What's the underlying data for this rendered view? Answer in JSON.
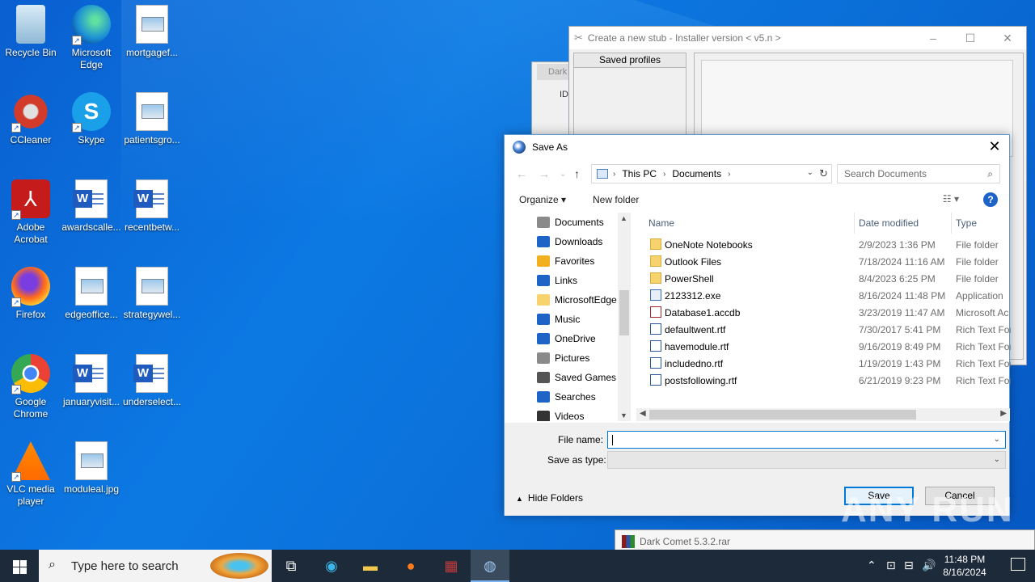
{
  "desktop": {
    "icons": [
      {
        "label": "Recycle Bin"
      },
      {
        "label": "Microsoft Edge"
      },
      {
        "label": "mortgagef..."
      },
      {
        "label": "CCleaner"
      },
      {
        "label": "Skype"
      },
      {
        "label": "patientsgro..."
      },
      {
        "label": "Adobe Acrobat"
      },
      {
        "label": "awardscalle..."
      },
      {
        "label": "recentbetw..."
      },
      {
        "label": "Firefox"
      },
      {
        "label": "edgeoffice..."
      },
      {
        "label": "strategywel..."
      },
      {
        "label": "Google Chrome"
      },
      {
        "label": "januaryvisit..."
      },
      {
        "label": "underselect..."
      },
      {
        "label": "VLC media player"
      },
      {
        "label": "moduleal.jpg"
      }
    ]
  },
  "stub_window": {
    "title": "Create a new stub - Installer version < v5.n >",
    "saved_profiles_label": "Saved profiles",
    "behind_tab": "Dark",
    "behind_col": "ID"
  },
  "dialog": {
    "title": "Save As",
    "breadcrumb": [
      "This PC",
      "Documents"
    ],
    "search_placeholder": "Search Documents",
    "organize_label": "Organize",
    "new_folder_label": "New folder",
    "tree": [
      {
        "label": "Documents",
        "icon": "documents-icon",
        "color": "#8a8a8a"
      },
      {
        "label": "Downloads",
        "icon": "downloads-icon",
        "color": "#1e63c8"
      },
      {
        "label": "Favorites",
        "icon": "star-icon",
        "color": "#f2b01e"
      },
      {
        "label": "Links",
        "icon": "links-icon",
        "color": "#1e63c8"
      },
      {
        "label": "MicrosoftEdge",
        "icon": "folder-icon",
        "color": "#f6d36d"
      },
      {
        "label": "Music",
        "icon": "music-icon",
        "color": "#1e63c8"
      },
      {
        "label": "OneDrive",
        "icon": "onedrive-icon",
        "color": "#1e63c8"
      },
      {
        "label": "Pictures",
        "icon": "pictures-icon",
        "color": "#8a8a8a"
      },
      {
        "label": "Saved Games",
        "icon": "saved-games-icon",
        "color": "#555555"
      },
      {
        "label": "Searches",
        "icon": "search-icon",
        "color": "#1e63c8"
      },
      {
        "label": "Videos",
        "icon": "videos-icon",
        "color": "#333333"
      }
    ],
    "columns": {
      "name": "Name",
      "date": "Date modified",
      "type": "Type"
    },
    "files": [
      {
        "name": "OneNote Notebooks",
        "date": "2/9/2023 1:36 PM",
        "type": "File folder",
        "kind": "folder"
      },
      {
        "name": "Outlook Files",
        "date": "7/18/2024 11:16 AM",
        "type": "File folder",
        "kind": "folder"
      },
      {
        "name": "PowerShell",
        "date": "8/4/2023 6:25 PM",
        "type": "File folder",
        "kind": "folder"
      },
      {
        "name": "2123312.exe",
        "date": "8/16/2024 11:48 PM",
        "type": "Application",
        "kind": "exe"
      },
      {
        "name": "Database1.accdb",
        "date": "3/23/2019 11:47 AM",
        "type": "Microsoft Ac",
        "kind": "accdb"
      },
      {
        "name": "defaultwent.rtf",
        "date": "7/30/2017 5:41 PM",
        "type": "Rich Text For",
        "kind": "rtf"
      },
      {
        "name": "havemodule.rtf",
        "date": "9/16/2019 8:49 PM",
        "type": "Rich Text For",
        "kind": "rtf"
      },
      {
        "name": "includedno.rtf",
        "date": "1/19/2019 1:43 PM",
        "type": "Rich Text For",
        "kind": "rtf"
      },
      {
        "name": "postsfollowing.rtf",
        "date": "6/21/2019 9:23 PM",
        "type": "Rich Text For",
        "kind": "rtf"
      }
    ],
    "file_name_label": "File name:",
    "file_name_value": "",
    "save_as_type_label": "Save as type:",
    "save_as_type_value": "",
    "hide_folders_label": "Hide Folders",
    "save_label": "Save",
    "cancel_label": "Cancel"
  },
  "rar_window": {
    "title": "Dark Comet 5.3.2.rar"
  },
  "watermark": "ANY RUN",
  "taskbar": {
    "search_placeholder": "Type here to search",
    "time": "11:48 PM",
    "date": "8/16/2024"
  }
}
